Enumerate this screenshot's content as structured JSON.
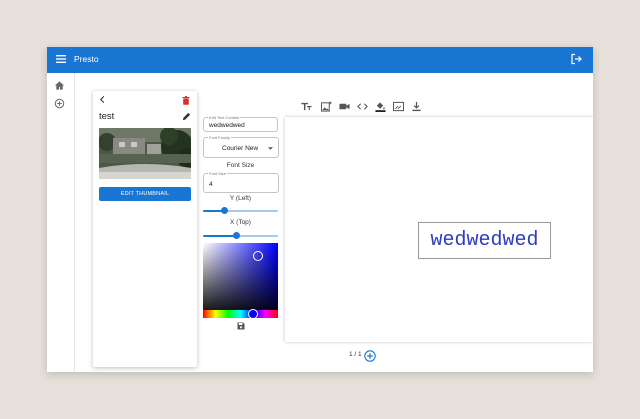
{
  "app": {
    "title": "Presto"
  },
  "sidebar": {
    "items": [
      {
        "icon": "home-icon"
      },
      {
        "icon": "add-circle-icon"
      }
    ]
  },
  "presentation": {
    "title": "test",
    "edit_thumbnail_label": "EDIT THUMBNAIL"
  },
  "editor": {
    "text_content": {
      "label": "Edit Text Content",
      "value": "wedwedwed"
    },
    "font_family": {
      "label": "Font Family",
      "value": "Courier New"
    },
    "font_size_heading": "Font Size",
    "font_size": {
      "label": "Font Size",
      "value": "4"
    },
    "y_label": "Y (Left)",
    "y_value": 0.29,
    "x_label": "X (Top)",
    "x_value": 0.45,
    "color": "#2f3dbd"
  },
  "toolbar": {
    "tools": [
      "text-size-icon",
      "add-image-icon",
      "video-icon",
      "code-icon",
      "fill-color-icon",
      "background-icon",
      "download-icon"
    ]
  },
  "slide": {
    "text": "wedwedwed"
  },
  "pagination": {
    "label": "1 / 1"
  },
  "colors": {
    "primary": "#1976d2",
    "text_color": "#2f3dbd"
  }
}
